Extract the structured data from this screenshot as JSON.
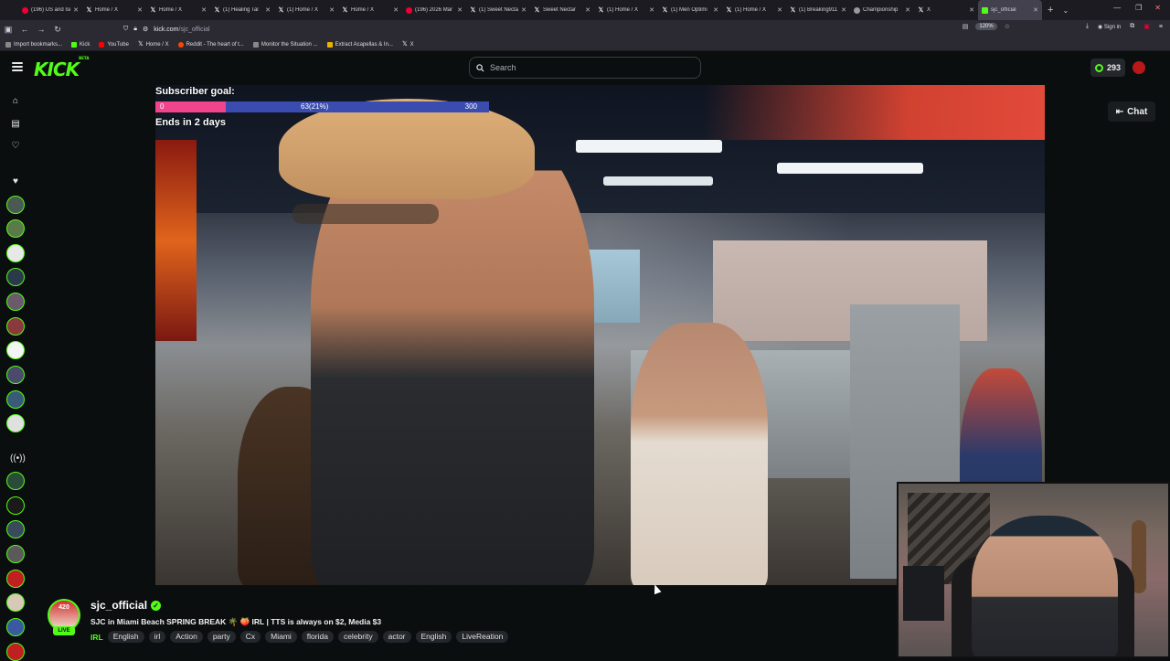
{
  "browser": {
    "tabs": [
      {
        "label": "(196) US and Isr",
        "favicon": "youtube"
      },
      {
        "label": "Home / X",
        "favicon": "x"
      },
      {
        "label": "Home / X",
        "favicon": "x"
      },
      {
        "label": "(1) Healing Tal",
        "favicon": "x"
      },
      {
        "label": "(1) Home / X",
        "favicon": "x"
      },
      {
        "label": "Home / X",
        "favicon": "x"
      },
      {
        "label": "(196) 2026 Mar",
        "favicon": "youtube"
      },
      {
        "label": "(1) Sweet Necta",
        "favicon": "x"
      },
      {
        "label": "Sweet Nectar",
        "favicon": "x"
      },
      {
        "label": "(1) Home / X",
        "favicon": "x"
      },
      {
        "label": "(1) Men Optimi",
        "favicon": "x"
      },
      {
        "label": "(1) Home / X",
        "favicon": "x"
      },
      {
        "label": "(1) Breaking911",
        "favicon": "x"
      },
      {
        "label": "Championship",
        "favicon": "generic"
      },
      {
        "label": "X",
        "favicon": "x"
      },
      {
        "label": "sjc_official",
        "favicon": "kick",
        "active": true
      }
    ],
    "url_host": "kick.com",
    "url_path": "/sjc_official",
    "zoom": "120%",
    "signin": "Sign in",
    "bookmarks": [
      {
        "label": "Import bookmarks...",
        "icon": "import"
      },
      {
        "label": "Kick",
        "icon": "kick"
      },
      {
        "label": "YouTube",
        "icon": "youtube"
      },
      {
        "label": "Home / X",
        "icon": "x"
      },
      {
        "label": "Reddit - The heart of t...",
        "icon": "reddit"
      },
      {
        "label": "Monitor the Situation ...",
        "icon": "generic"
      },
      {
        "label": "Extract Acapellas & In...",
        "icon": "yellow"
      },
      {
        "label": "X",
        "icon": "x"
      }
    ]
  },
  "header": {
    "logo": "KICK",
    "logo_badge": "BETA",
    "search_placeholder": "Search",
    "points": "293"
  },
  "subscriber_goal": {
    "title": "Subscriber goal:",
    "start": "0",
    "current_label": "63(21%)",
    "end": "300",
    "progress": 0.21,
    "ends": "Ends in 2 days"
  },
  "chat_button": "Chat",
  "streamer": {
    "name": "sjc_official",
    "live_badge": "LIVE",
    "avatar_text": "420",
    "title": "SJC in Miami Beach SPRING BREAK 🌴 🍑 IRL | TTS is always on $2, Media $3",
    "category": "IRL",
    "tags": [
      "English",
      "irl",
      "Action",
      "party",
      "Cx",
      "Miami",
      "florida",
      "celebrity",
      "actor",
      "English",
      "LiveReation"
    ]
  },
  "colors": {
    "accent": "#53fc18",
    "goal_fill": "#f0458c",
    "goal_bar": "#3a4cb0"
  }
}
